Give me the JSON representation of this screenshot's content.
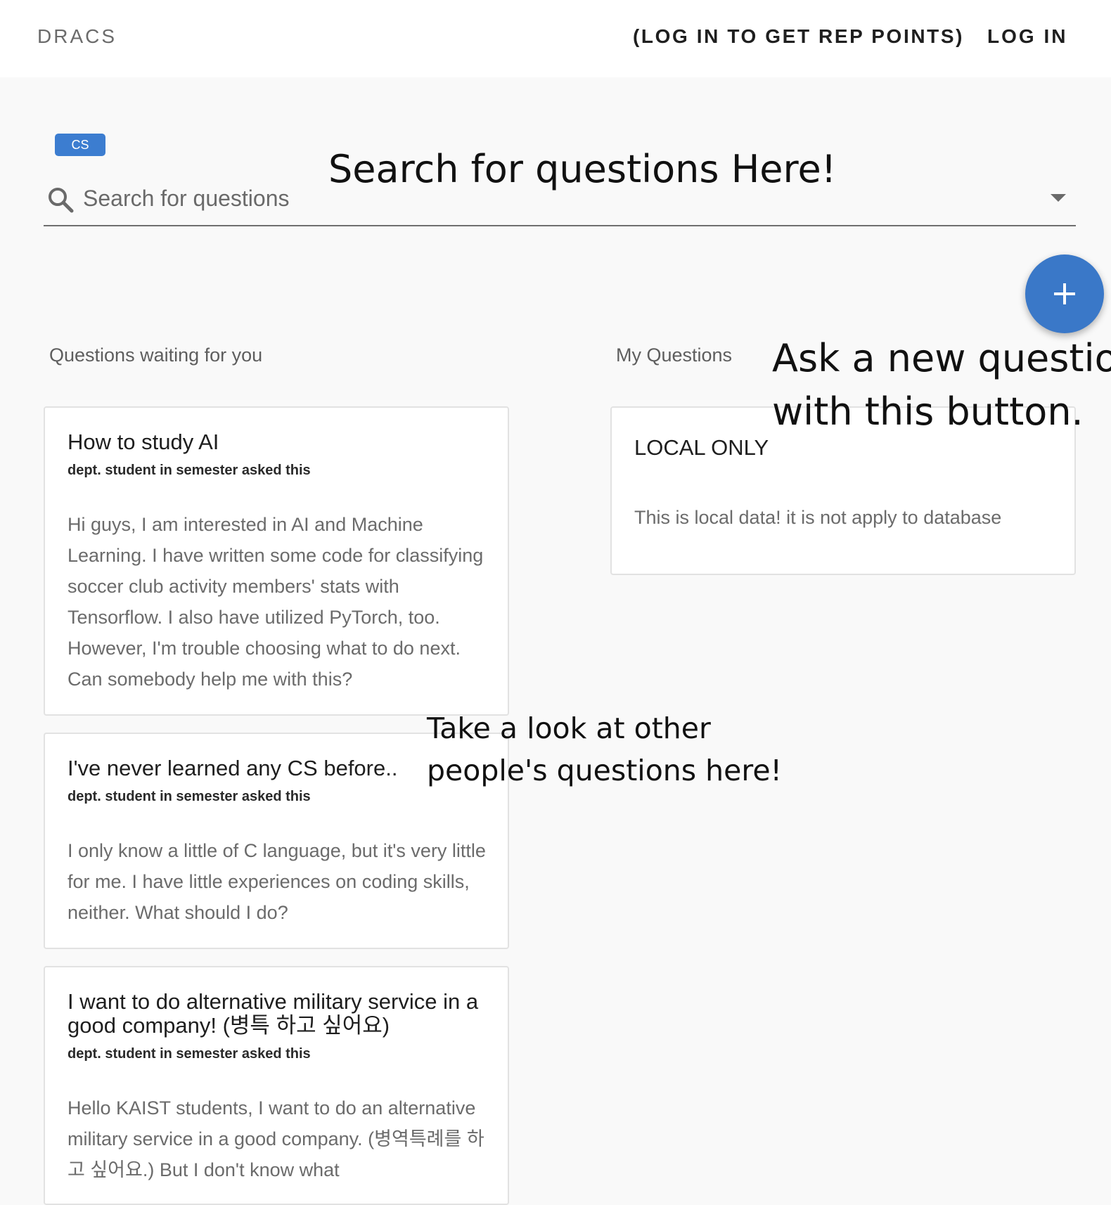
{
  "header": {
    "brand": "DRACS",
    "rep_link": "(LOG IN TO GET REP POINTS)",
    "login": "LOG IN"
  },
  "filter": {
    "chip_label": "CS"
  },
  "search": {
    "placeholder": "Search for questions"
  },
  "fab": {
    "icon": "plus-icon",
    "color": "#3a78c8"
  },
  "sections": {
    "waiting": "Questions waiting for you",
    "mine": "My Questions"
  },
  "waiting_questions": [
    {
      "title": "How to study AI",
      "meta": "dept. student in semester asked this",
      "body": "Hi guys, I am interested in AI and Machine Learning. I have written some code for classifying soccer club activity members' stats with Tensorflow. I also have utilized PyTorch, too. However, I'm trouble choosing what to do next. Can somebody help me with this?"
    },
    {
      "title": "I've never learned any CS before..",
      "meta": "dept. student in semester asked this",
      "body": "I only know a little of C language, but it's very little for me. I have little experiences on coding skills, neither. What should I do?"
    },
    {
      "title": "I want to do alternative military service in a good company! (병특 하고 싶어요)",
      "meta": "dept. student in semester asked this",
      "body": "Hello KAIST students, I want to do an alternative military service in a good company. (병역특례를 하고 싶어요.) But I don't know what"
    }
  ],
  "my_questions": [
    {
      "title": "LOCAL ONLY",
      "body": "This is local data! it is not apply to database"
    }
  ],
  "annotations": {
    "search": "Search for questions Here!",
    "ask": [
      "Ask a new question",
      "with this button."
    ],
    "look": [
      "Take a look at other",
      "people's questions here!"
    ]
  },
  "colors": {
    "accent": "#3c7dd0",
    "background": "#f9f9f9"
  }
}
